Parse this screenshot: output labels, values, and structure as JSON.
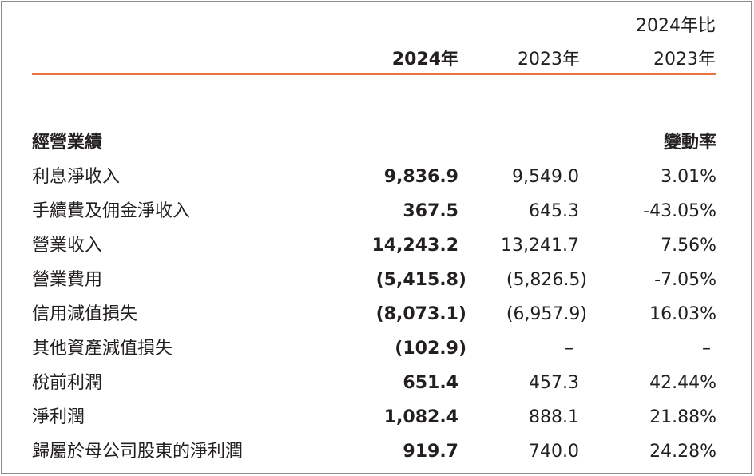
{
  "header": {
    "col_2024": "2024年",
    "col_2023": "2023年",
    "col_change_line1": "2024年比",
    "col_change_line2": "2023年"
  },
  "section": {
    "title": "經營業績",
    "change_label": "變動率"
  },
  "rows": [
    {
      "label": "利息淨收入",
      "v2024": "9,836.9",
      "v2023": "9,549.0",
      "change": "3.01%"
    },
    {
      "label": "手續費及佣金淨收入",
      "v2024": "367.5",
      "v2023": "645.3",
      "change": "-43.05%"
    },
    {
      "label": "營業收入",
      "v2024": "14,243.2",
      "v2023": "13,241.7",
      "change": "7.56%"
    },
    {
      "label": "營業費用",
      "v2024": "(5,415.8)",
      "v2023": "(5,826.5)",
      "change": "-7.05%"
    },
    {
      "label": "信用減值損失",
      "v2024": "(8,073.1)",
      "v2023": "(6,957.9)",
      "change": "16.03%"
    },
    {
      "label": "其他資產減值損失",
      "v2024": "(102.9)",
      "v2023": "–",
      "change": "–"
    },
    {
      "label": "稅前利潤",
      "v2024": "651.4",
      "v2023": "457.3",
      "change": "42.44%"
    },
    {
      "label": "淨利潤",
      "v2024": "1,082.4",
      "v2023": "888.1",
      "change": "21.88%"
    },
    {
      "label": "歸屬於母公司股東的淨利潤",
      "v2024": "919.7",
      "v2023": "740.0",
      "change": "24.28%"
    }
  ],
  "colors": {
    "rule": "#e8743b",
    "text": "#231f20",
    "border": "#8c8c8c"
  }
}
